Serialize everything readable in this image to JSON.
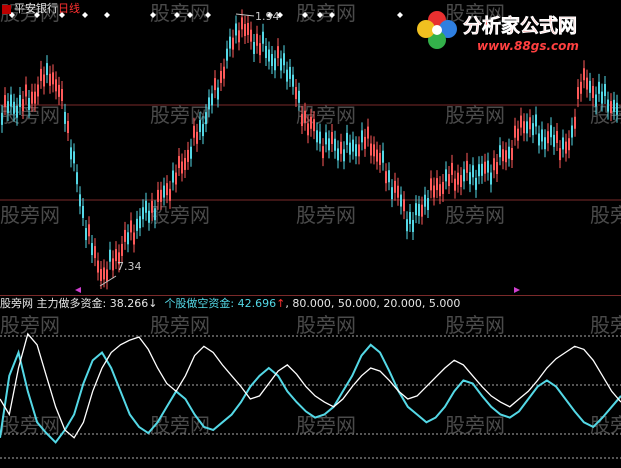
{
  "header": {
    "stock_name": "平安银行",
    "period": "日线"
  },
  "logo": {
    "title": "分析家公式网",
    "url_text": "www.88gs.com"
  },
  "price_chart": {
    "high_marker": "1.94",
    "low_marker": "7.34"
  },
  "indicator": {
    "name": "股旁网",
    "main_label": "主力做多资金:",
    "main_value": "38.266",
    "main_arrow": "↓",
    "retail_label": "个股做空资金:",
    "retail_value": "42.696",
    "retail_arrow": "↑",
    "levels": [
      "80.000",
      "50.000",
      "20.000",
      "5.000"
    ]
  },
  "watermark": "股旁网",
  "colors": {
    "background": "#000000",
    "up_candle": "#ff5a5a",
    "down_candle": "#54d8e6",
    "main_line": "#ffffff",
    "retail_line": "#54d8e6",
    "divider": "#7a2a2a"
  },
  "chart_data": {
    "type": "line",
    "series": [
      {
        "name": "主力做多资金",
        "values": [
          40,
          30,
          60,
          82,
          75,
          55,
          35,
          20,
          15,
          25,
          45,
          60,
          70,
          75,
          78,
          80,
          72,
          60,
          50,
          45,
          55,
          68,
          74,
          70,
          62,
          55,
          48,
          40,
          42,
          50,
          58,
          62,
          56,
          48,
          42,
          38,
          35,
          40,
          48,
          55,
          60,
          58,
          52,
          45,
          40,
          42,
          48,
          54,
          60,
          65,
          62,
          55,
          48,
          42,
          38,
          35,
          40,
          45,
          52,
          60,
          66,
          70,
          74,
          72,
          65,
          55,
          45,
          38
        ]
      },
      {
        "name": "个股做空资金",
        "values": [
          15,
          55,
          70,
          45,
          25,
          18,
          12,
          20,
          30,
          50,
          65,
          70,
          60,
          45,
          30,
          22,
          18,
          25,
          35,
          45,
          40,
          30,
          22,
          20,
          25,
          30,
          38,
          48,
          55,
          60,
          55,
          45,
          38,
          32,
          28,
          30,
          35,
          45,
          55,
          68,
          75,
          70,
          58,
          45,
          35,
          30,
          25,
          28,
          35,
          45,
          52,
          50,
          42,
          35,
          30,
          28,
          32,
          40,
          48,
          52,
          48,
          40,
          32,
          25,
          22,
          28,
          35,
          42
        ]
      }
    ]
  }
}
